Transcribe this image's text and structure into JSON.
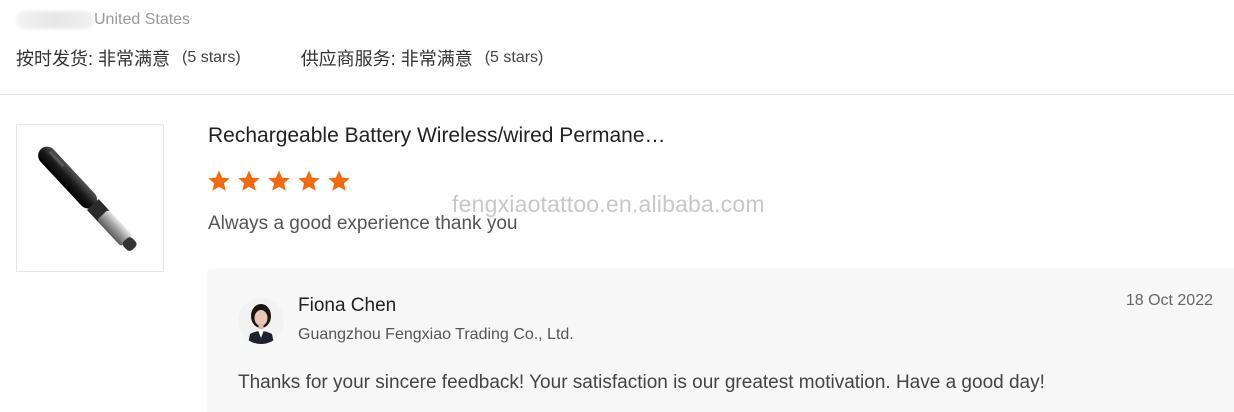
{
  "header": {
    "country": "United States",
    "ratings": [
      {
        "label": "按时发货: 非常满意",
        "stars_text": "(5 stars)"
      },
      {
        "label": "供应商服务: 非常满意",
        "stars_text": "(5 stars)"
      }
    ]
  },
  "review": {
    "product_title": "Rechargeable Battery Wireless/wired Permane…",
    "rating": 5,
    "text": "Always a good experience thank you",
    "star_color": "#f26a10"
  },
  "watermark": "fengxiaotattoo.en.alibaba.com",
  "reply": {
    "name": "Fiona Chen",
    "company": "Guangzhou Fengxiao Trading Co., Ltd.",
    "date": "18 Oct 2022",
    "text": "Thanks for your sincere feedback! Your satisfaction is our greatest motivation. Have a good day!"
  }
}
